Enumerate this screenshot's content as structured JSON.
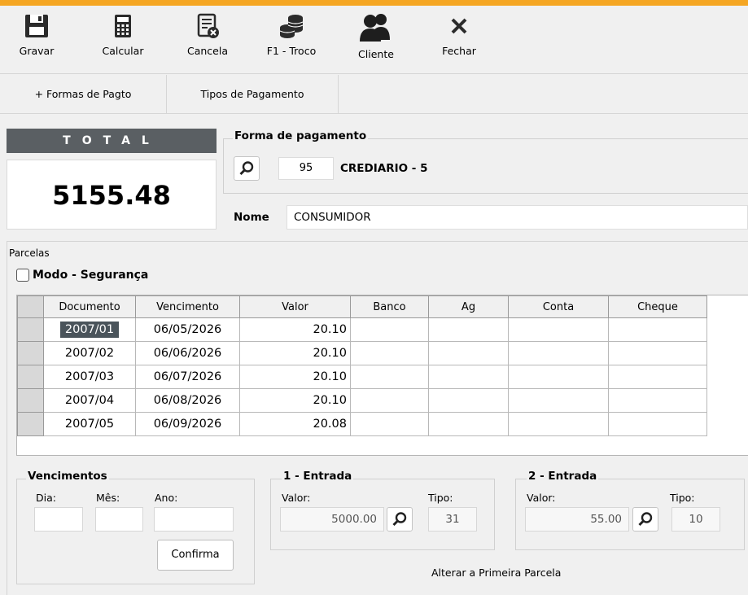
{
  "toolbar": {
    "gravar": "Gravar",
    "calcular": "Calcular",
    "cancela": "Cancela",
    "troco": "F1 - Troco",
    "cliente": "Cliente",
    "fechar": "Fechar"
  },
  "tabs": [
    "+ Formas de Pagto",
    "Tipos de Pagamento"
  ],
  "total": {
    "label": "TOTAL",
    "value": "5155.48"
  },
  "forma_pagamento": {
    "title": "Forma de pagamento",
    "code": "95",
    "name": "CREDIARIO - 5",
    "nome_label": "Nome",
    "nome_value": "CONSUMIDOR"
  },
  "parcelas": {
    "label": "Parcelas",
    "modo_seguranca": "Modo - Segurança",
    "columns": [
      "Documento",
      "Vencimento",
      "Valor",
      "Banco",
      "Ag",
      "Conta",
      "Cheque"
    ],
    "rows": [
      [
        "2007/01",
        "06/05/2026",
        "20.10",
        "",
        "",
        "",
        ""
      ],
      [
        "2007/02",
        "06/06/2026",
        "20.10",
        "",
        "",
        "",
        ""
      ],
      [
        "2007/03",
        "06/07/2026",
        "20.10",
        "",
        "",
        "",
        ""
      ],
      [
        "2007/04",
        "06/08/2026",
        "20.10",
        "",
        "",
        "",
        ""
      ],
      [
        "2007/05",
        "06/09/2026",
        "20.08",
        "",
        "",
        "",
        ""
      ]
    ]
  },
  "vencimentos": {
    "title": "Vencimentos",
    "dia": "Dia:",
    "mes": "Mês:",
    "ano": "Ano:",
    "confirma": "Confirma"
  },
  "entrada1": {
    "title": "1 - Entrada",
    "valor_label": "Valor:",
    "tipo_label": "Tipo:",
    "valor": "5000.00",
    "tipo": "31"
  },
  "entrada2": {
    "title": "2 - Entrada",
    "valor_label": "Valor:",
    "tipo_label": "Tipo:",
    "valor": "55.00",
    "tipo": "10"
  },
  "alterar_label": "Alterar a Primeira Parcela",
  "colors": {
    "accent": "#f5a623",
    "header_dark": "#5a5f63",
    "selection": "#4a545b"
  }
}
